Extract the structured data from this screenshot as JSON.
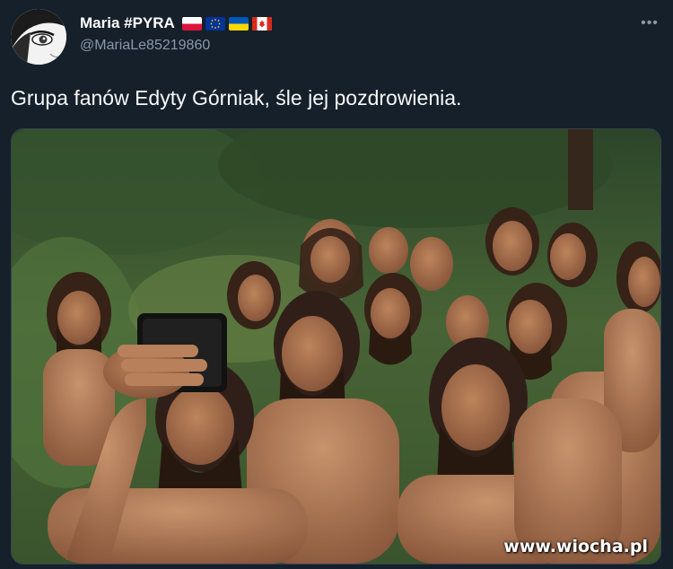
{
  "tweet": {
    "display_name": "Maria #PYRA",
    "handle": "@MariaLe85219860",
    "more_label": "•••",
    "text": "Grupa fanów Edyty Górniak, śle jej pozdrowienia.",
    "flags": [
      "poland-flag-icon",
      "eu-flag-icon",
      "ukraine-flag-icon",
      "canada-flag-icon"
    ]
  },
  "media": {
    "watermark": "www.wiocha.pl"
  },
  "colors": {
    "background": "#15202b",
    "secondary_text": "#8b98a5"
  }
}
